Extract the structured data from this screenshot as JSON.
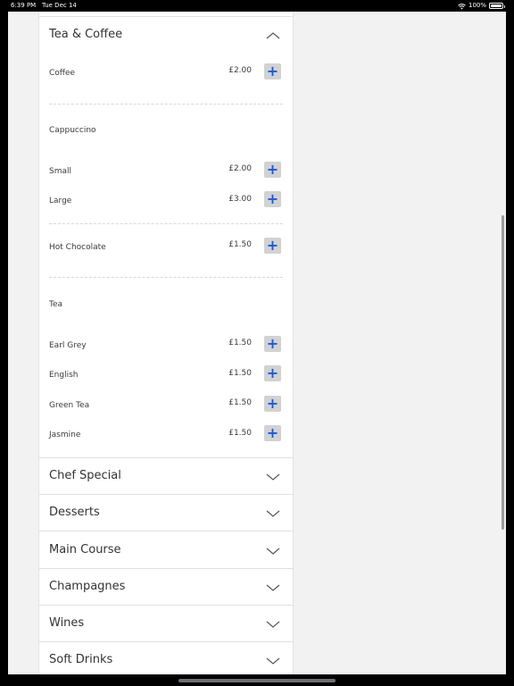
{
  "status": {
    "time": "6:39 PM",
    "date": "Tue Dec 14",
    "battery": "100%"
  },
  "tea_coffee": {
    "title": "Tea & Coffee",
    "coffee": {
      "name": "Coffee",
      "price": "£2.00"
    },
    "cappuccino": {
      "label": "Cappuccino",
      "small": {
        "name": "Small",
        "price": "£2.00"
      },
      "large": {
        "name": "Large",
        "price": "£3.00"
      }
    },
    "hot_chocolate": {
      "name": "Hot Chocolate",
      "price": "£1.50"
    },
    "tea": {
      "label": "Tea",
      "earl_grey": {
        "name": "Earl Grey",
        "price": "£1.50"
      },
      "english": {
        "name": "English",
        "price": "£1.50"
      },
      "green_tea": {
        "name": "Green Tea",
        "price": "£1.50"
      },
      "jasmine": {
        "name": "Jasmine",
        "price": "£1.50"
      }
    }
  },
  "add_symbol": "+",
  "sections": {
    "chef_special": "Chef Special",
    "desserts": "Desserts",
    "main_course": "Main Course",
    "champagnes": "Champagnes",
    "wines": "Wines",
    "soft_drinks": "Soft Drinks"
  },
  "icons": {
    "expanded": "chevron-up-icon",
    "collapsed": "chevron-down-icon",
    "add": "plus-icon"
  },
  "colors": {
    "accent": "#1a5ad6",
    "button_bg": "#d2d2d4",
    "background": "#f2f2f3"
  }
}
